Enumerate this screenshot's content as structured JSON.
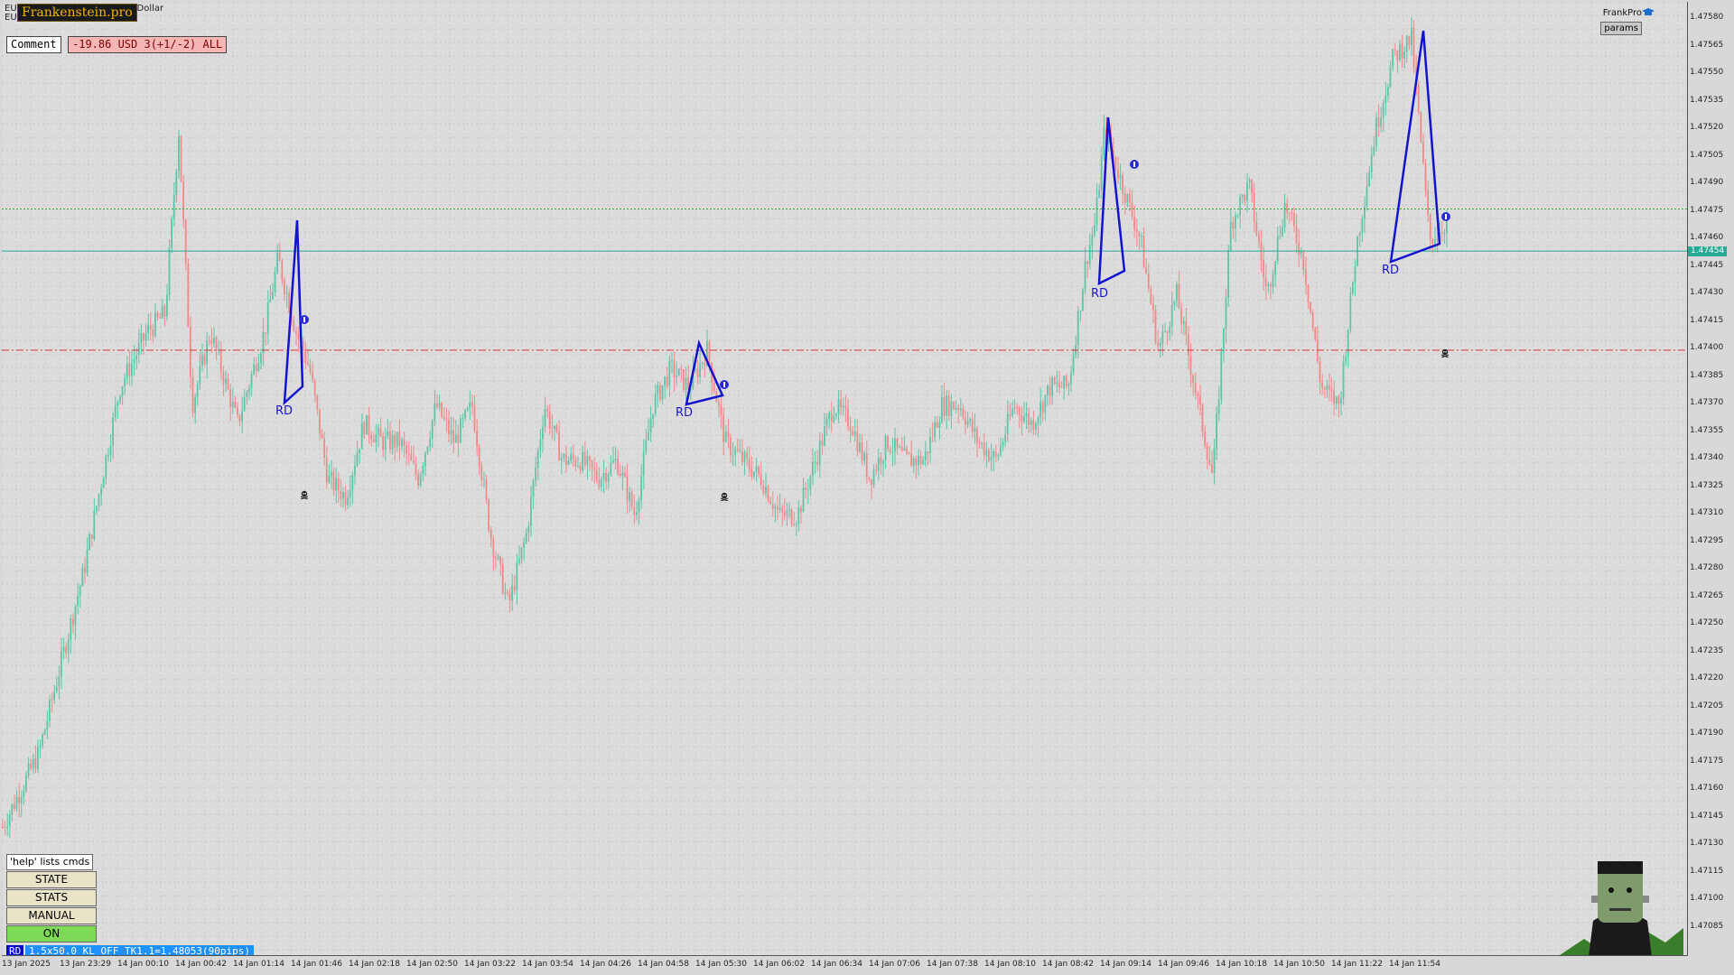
{
  "window": {
    "symbol_short": "EU",
    "symbol_line2": "EU",
    "title_suffix": "n Dollar",
    "brand": "Frankenstein.pro"
  },
  "comment": {
    "label": "Comment",
    "value": "-19.86 USD 3(+1/-2) ALL"
  },
  "top_right": {
    "frankpro_label": "FrankPro",
    "params_label": "params"
  },
  "side_panel": {
    "help_label": "'help' lists cmds",
    "buttons": [
      {
        "label": "STATE",
        "color": "#e9e4c8"
      },
      {
        "label": "STATS",
        "color": "#e9e4c8"
      },
      {
        "label": "MANUAL",
        "color": "#e9e4c8"
      },
      {
        "label": "ON",
        "color": "#7ed957"
      }
    ]
  },
  "status_bar": {
    "mode": "RD",
    "text": "1.5x50.0 KL_OFF TK1.1=1.48053(90pips)"
  },
  "current_price": "1.47454",
  "colors": {
    "bull": "#5fc4a8",
    "bear": "#f08a8a",
    "pattern": "#1414d0",
    "green_dotted": "#33aa33",
    "red_dashdot": "#e03030",
    "current_line": "#2aa896"
  },
  "rd_labels": [
    "RD",
    "RD",
    "RD",
    "RD"
  ],
  "price_axis": [
    "1.47580",
    "1.47565",
    "1.47550",
    "1.47535",
    "1.47520",
    "1.47505",
    "1.47490",
    "1.47475",
    "1.47460",
    "1.47445",
    "1.47430",
    "1.47415",
    "1.47400",
    "1.47385",
    "1.47370",
    "1.47355",
    "1.47340",
    "1.47325",
    "1.47310",
    "1.47295",
    "1.47280",
    "1.47265",
    "1.47250",
    "1.47235",
    "1.47220",
    "1.47205",
    "1.47190",
    "1.47175",
    "1.47160",
    "1.47145",
    "1.47130",
    "1.47115",
    "1.47100",
    "1.47085"
  ],
  "time_axis": [
    "13 Jan 2025",
    "13 Jan 23:29",
    "14 Jan 00:10",
    "14 Jan 00:42",
    "14 Jan 01:14",
    "14 Jan 01:46",
    "14 Jan 02:18",
    "14 Jan 02:50",
    "14 Jan 03:22",
    "14 Jan 03:54",
    "14 Jan 04:26",
    "14 Jan 04:58",
    "14 Jan 05:30",
    "14 Jan 06:02",
    "14 Jan 06:34",
    "14 Jan 07:06",
    "14 Jan 07:38",
    "14 Jan 08:10",
    "14 Jan 08:42",
    "14 Jan 09:14",
    "14 Jan 09:46",
    "14 Jan 10:18",
    "14 Jan 10:50",
    "14 Jan 11:22",
    "14 Jan 11:54"
  ],
  "chart_data": {
    "type": "candlestick",
    "symbol": "EU",
    "ylim": [
      1.4707,
      1.4759
    ],
    "levels": [
      {
        "name": "green_dotted",
        "price": 1.47477
      },
      {
        "name": "current_price",
        "price": 1.47454
      },
      {
        "name": "red_dashdot",
        "price": 1.474
      }
    ],
    "close_path": [
      [
        0,
        1.4714
      ],
      [
        40,
        1.4718
      ],
      [
        90,
        1.4728
      ],
      [
        130,
        1.4738
      ],
      [
        160,
        1.4741
      ],
      [
        180,
        1.4742
      ],
      [
        195,
        1.4752
      ],
      [
        210,
        1.4737
      ],
      [
        230,
        1.4741
      ],
      [
        260,
        1.4736
      ],
      [
        290,
        1.4741
      ],
      [
        305,
        1.4745
      ],
      [
        325,
        1.4741
      ],
      [
        340,
        1.4739
      ],
      [
        360,
        1.4733
      ],
      [
        380,
        1.4732
      ],
      [
        400,
        1.4736
      ],
      [
        420,
        1.4735
      ],
      [
        440,
        1.4735
      ],
      [
        460,
        1.4733
      ],
      [
        480,
        1.4737
      ],
      [
        500,
        1.4735
      ],
      [
        520,
        1.4737
      ],
      [
        540,
        1.473
      ],
      [
        560,
        1.4726
      ],
      [
        580,
        1.473
      ],
      [
        600,
        1.4737
      ],
      [
        620,
        1.4734
      ],
      [
        640,
        1.4734
      ],
      [
        660,
        1.4733
      ],
      [
        680,
        1.4734
      ],
      [
        700,
        1.4731
      ],
      [
        720,
        1.4737
      ],
      [
        740,
        1.4739
      ],
      [
        760,
        1.4738
      ],
      [
        780,
        1.474
      ],
      [
        800,
        1.4735
      ],
      [
        820,
        1.4734
      ],
      [
        840,
        1.4733
      ],
      [
        860,
        1.4731
      ],
      [
        880,
        1.4731
      ],
      [
        900,
        1.4734
      ],
      [
        920,
        1.4737
      ],
      [
        940,
        1.4736
      ],
      [
        960,
        1.4733
      ],
      [
        980,
        1.4735
      ],
      [
        1000,
        1.4734
      ],
      [
        1020,
        1.4734
      ],
      [
        1040,
        1.4737
      ],
      [
        1060,
        1.4737
      ],
      [
        1080,
        1.4735
      ],
      [
        1100,
        1.4734
      ],
      [
        1120,
        1.4737
      ],
      [
        1140,
        1.4736
      ],
      [
        1160,
        1.4738
      ],
      [
        1180,
        1.4738
      ],
      [
        1200,
        1.4745
      ],
      [
        1210,
        1.4747
      ],
      [
        1220,
        1.4752
      ],
      [
        1240,
        1.4749
      ],
      [
        1260,
        1.4746
      ],
      [
        1280,
        1.474
      ],
      [
        1300,
        1.4743
      ],
      [
        1320,
        1.4738
      ],
      [
        1340,
        1.4733
      ],
      [
        1360,
        1.4747
      ],
      [
        1380,
        1.4749
      ],
      [
        1400,
        1.4743
      ],
      [
        1420,
        1.4748
      ],
      [
        1440,
        1.4745
      ],
      [
        1460,
        1.4738
      ],
      [
        1480,
        1.4737
      ],
      [
        1500,
        1.4746
      ],
      [
        1520,
        1.4752
      ],
      [
        1540,
        1.4756
      ],
      [
        1560,
        1.4757
      ],
      [
        1580,
        1.4746
      ],
      [
        1600,
        1.4747
      ]
    ]
  }
}
